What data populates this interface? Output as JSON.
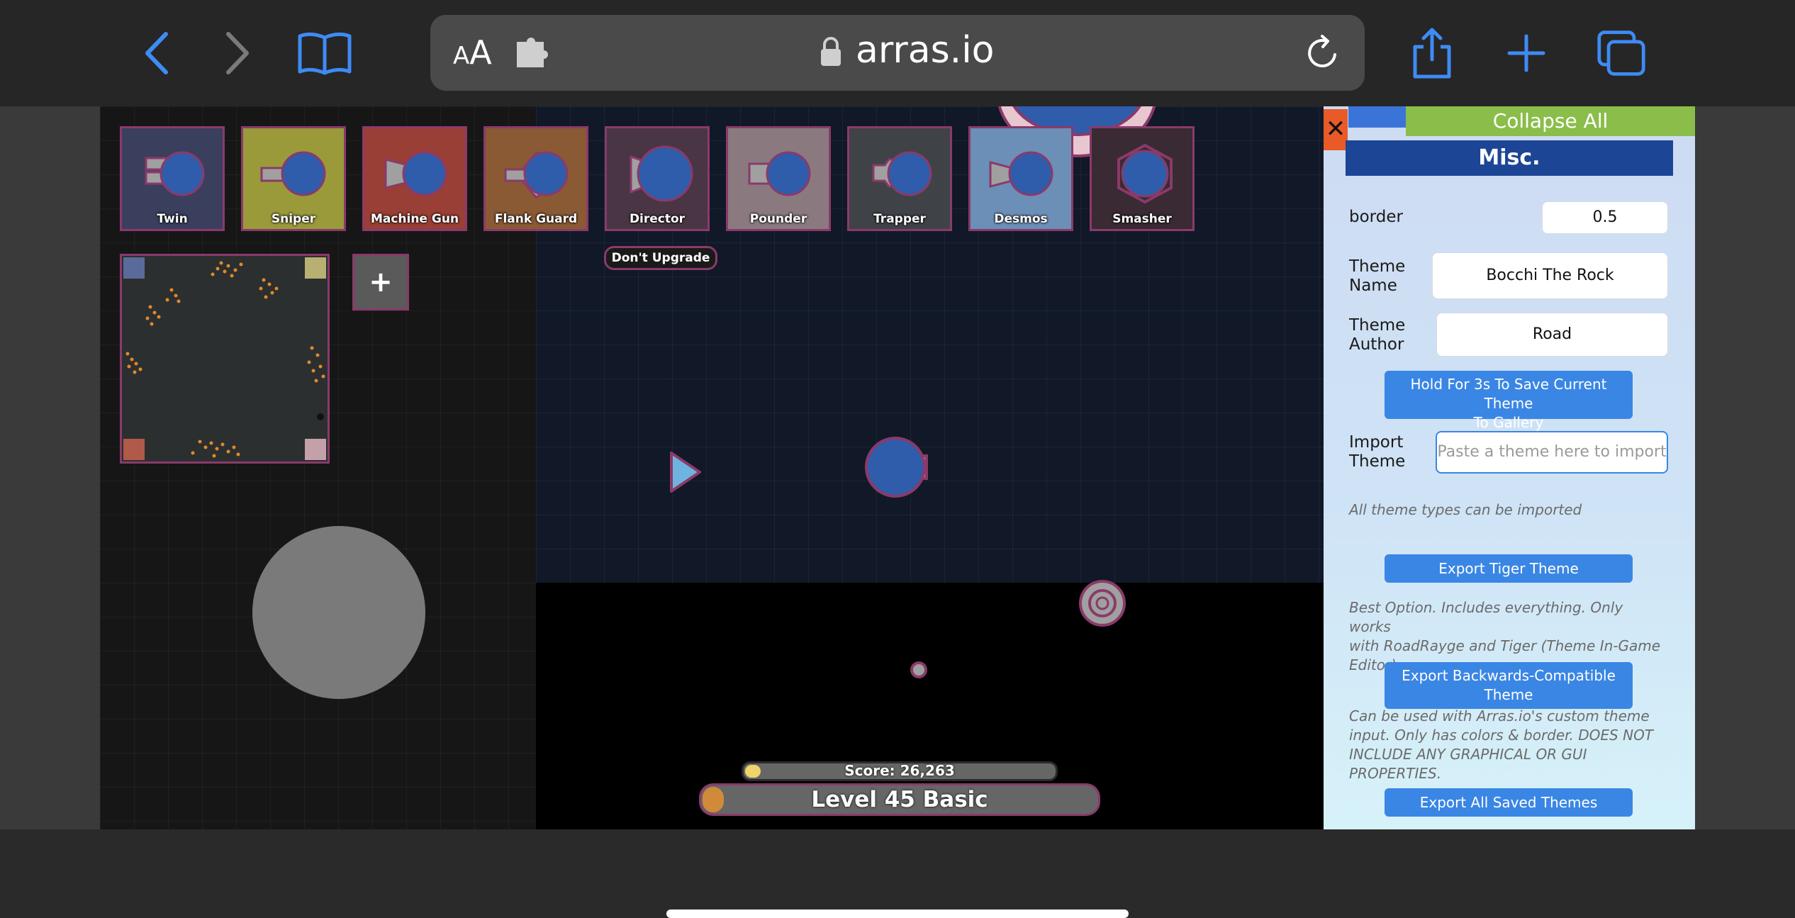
{
  "browser": {
    "url": "arras.io",
    "text_size_label_small": "A",
    "text_size_label_large": "A"
  },
  "game": {
    "upgrades": [
      {
        "label": "Twin",
        "bg": "#3a3f5e"
      },
      {
        "label": "Sniper",
        "bg": "#9a9a3a"
      },
      {
        "label": "Machine Gun",
        "bg": "#9a3f35"
      },
      {
        "label": "Flank Guard",
        "bg": "#8a5a35"
      },
      {
        "label": "Director",
        "bg": "#4a3544"
      },
      {
        "label": "Pounder",
        "bg": "#8a7a80"
      },
      {
        "label": "Trapper",
        "bg": "#3f4348"
      },
      {
        "label": "Desmos",
        "bg": "#6c8fb8"
      },
      {
        "label": "Smasher",
        "bg": "#3a2a33"
      }
    ],
    "dont_upgrade": "Don't Upgrade",
    "add_button": "+",
    "score": "Score: 26,263",
    "level": "Level 45 Basic",
    "score_progress": 0.05,
    "level_progress": 0.05
  },
  "panel": {
    "close": "✕",
    "collapse_all": "Collapse All",
    "section_title": "Misc.",
    "border_label": "border",
    "border_value": "0.5",
    "theme_name_label_1": "Theme",
    "theme_name_label_2": "Name",
    "theme_name_value": "Bocchi The Rock",
    "theme_author_label_1": "Theme",
    "theme_author_label_2": "Author",
    "theme_author_value": "Road",
    "save_button_1": "Hold For 3s To Save Current Theme",
    "save_button_2": "To Gallery",
    "import_label_1": "Import",
    "import_label_2": "Theme",
    "import_placeholder": "Paste a theme here to import",
    "import_hint": "All theme types can be imported",
    "export_tiger": "Export Tiger Theme",
    "tiger_hint_1": "Best Option. Includes everything. Only works",
    "tiger_hint_2": "with RoadRayge and Tiger (Theme In-Game",
    "tiger_hint_3": "Editor).",
    "export_compat_1": "Export Backwards-Compatible",
    "export_compat_2": "Theme",
    "compat_hint_1": "Can be used with Arras.io's custom theme",
    "compat_hint_2": "input. Only has colors & border. DOES NOT",
    "compat_hint_3": "INCLUDE ANY GRAPHICAL OR GUI",
    "compat_hint_4": "PROPERTIES.",
    "export_all": "Export All Saved Themes"
  }
}
